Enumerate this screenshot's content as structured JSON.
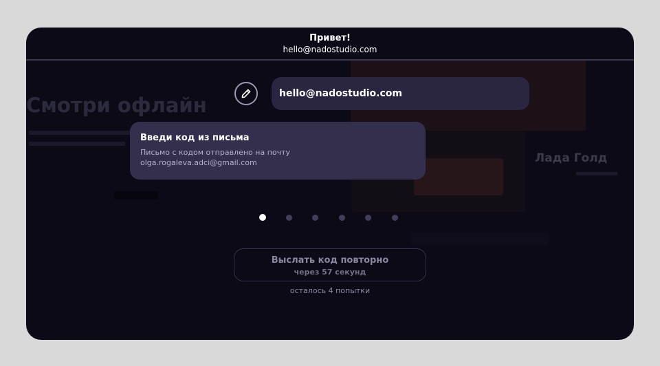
{
  "header": {
    "greeting": "Привет!",
    "email": "hello@nadostudio.com"
  },
  "background": {
    "title": "Смотри офлайн",
    "card_name": "Лада Голд"
  },
  "email_field": {
    "value": "hello@nadostudio.com",
    "edit_icon": "pencil-icon"
  },
  "code_card": {
    "title": "Введи код из письма",
    "note_line1": "Письмо с кодом отправлено на почту",
    "note_line2": "olga.rogaleva.adci@gmail.com"
  },
  "pagination": {
    "total": 6,
    "active_index": 0
  },
  "resend": {
    "label": "Выслать код повторно",
    "timer": "через 57 секунд"
  },
  "attempts_text": "осталось 4 попытки",
  "colors": {
    "page_bg": "#d9d9d9",
    "screen_bg": "#0c0a17",
    "field_bg": "#2a2540",
    "card_bg": "#352f4e",
    "dot_inactive": "#403e5a",
    "dot_active": "#ffffff"
  }
}
